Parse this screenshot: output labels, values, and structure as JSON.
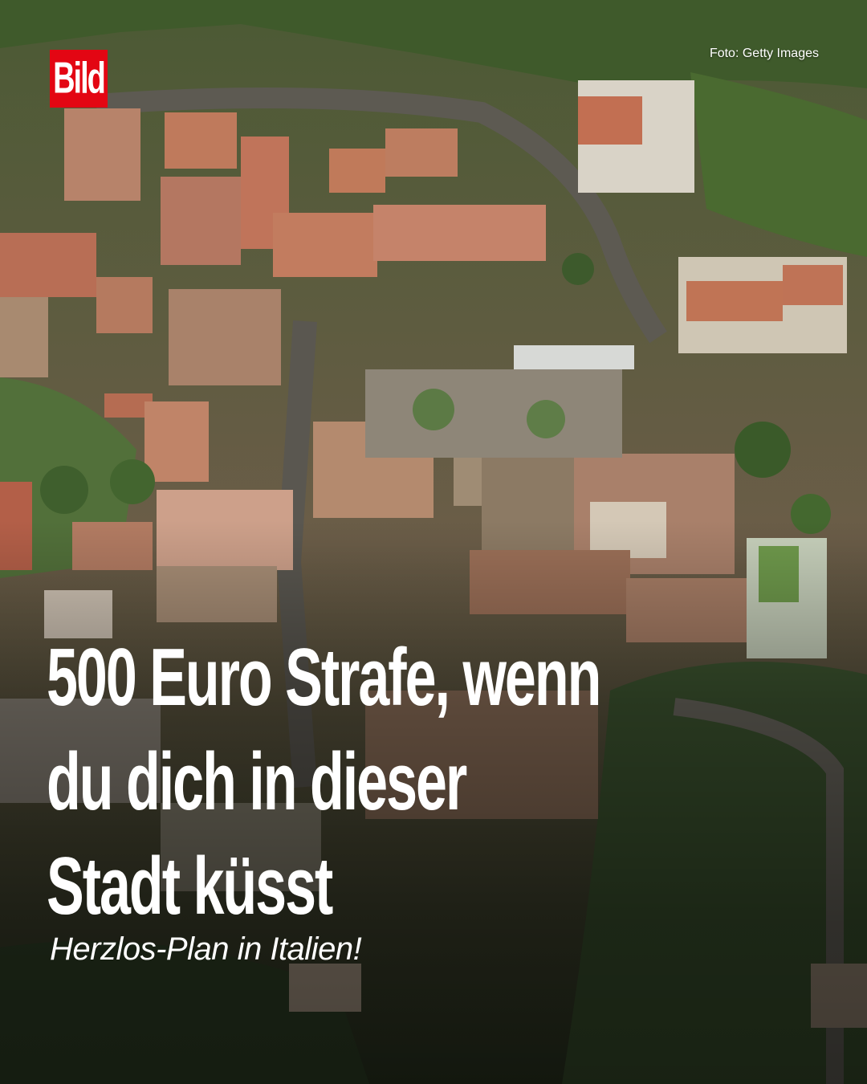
{
  "brand": {
    "logo_text": "Bild",
    "color": "#e30613"
  },
  "photo_credit": "Foto: Getty Images",
  "headline": {
    "lines": [
      "500 Euro Strafe, wenn",
      "du dich in dieser",
      "Stadt küsst"
    ]
  },
  "subline": "Herzlos-Plan in Italien!",
  "colors": {
    "text": "#ffffff",
    "logo_bg": "#e30613"
  }
}
